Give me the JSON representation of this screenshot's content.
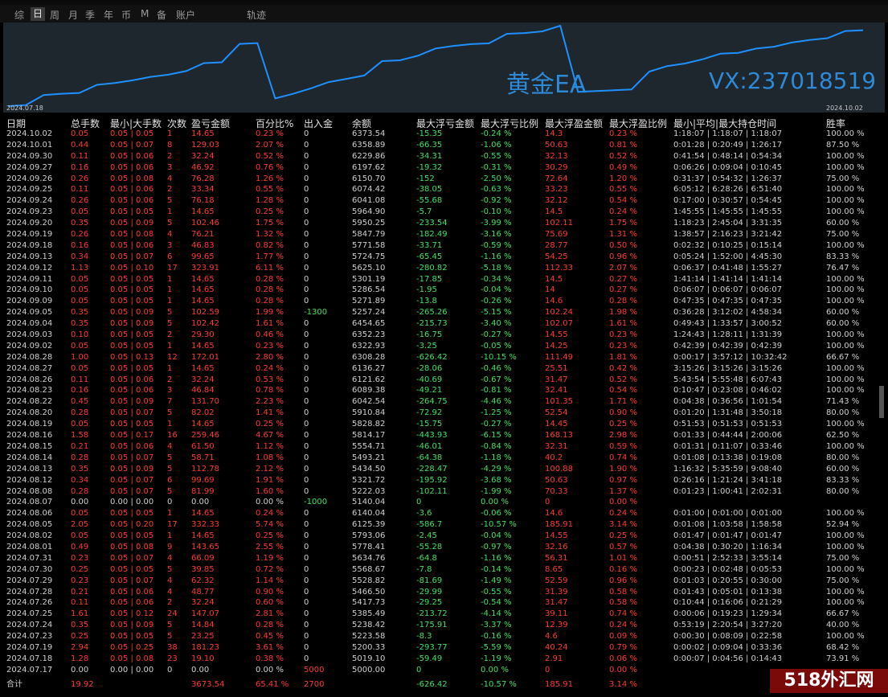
{
  "tabs": [
    {
      "label": "综"
    },
    {
      "label": "日"
    },
    {
      "label": "周"
    },
    {
      "label": "月"
    },
    {
      "label": "季"
    },
    {
      "label": "年"
    },
    {
      "label": "币"
    },
    {
      "label": "M"
    },
    {
      "label": "备"
    },
    {
      "label": "账户"
    },
    {
      "label": "轨迹"
    }
  ],
  "chart": {
    "date_start": "2024.07.18",
    "date_end": "2024.10.02",
    "watermark1": "黄金EA",
    "watermark2": "VX:237018519",
    "line_color": "#1e90ff",
    "values": [
      5000.0,
      5019.1,
      5200.33,
      5223.58,
      5238.42,
      5385.49,
      5417.73,
      5466.5,
      5528.82,
      5568.67,
      5634.76,
      5778.41,
      5793.06,
      6125.39,
      6140.04,
      5140.04,
      5222.03,
      5321.72,
      5434.5,
      5493.21,
      5554.71,
      5814.17,
      5828.82,
      5910.84,
      6042.54,
      6089.38,
      6121.62,
      6136.27,
      6308.28,
      6322.93,
      6352.23,
      6454.65,
      5257.24,
      5271.89,
      5286.54,
      5301.19,
      5625.1,
      5724.75,
      5771.58,
      5847.79,
      5950.25,
      5964.9,
      6041.08,
      6074.42,
      6150.7,
      6197.62,
      6229.86,
      6358.89,
      6373.54
    ]
  },
  "headers": [
    "日期",
    "总手数",
    "最小|大手数",
    "次数",
    "盈亏金额",
    "百分比%",
    "出入金",
    "余额",
    "最大浮亏金额",
    "最大浮亏比例",
    "最大浮盈金额",
    "最大浮盈比例",
    "最小|平均|最大持仓时间",
    "胜率"
  ],
  "rows": [
    [
      "2024.10.02",
      "0.05",
      "0.05 | 0.05",
      "1",
      "14.65",
      "0.23 %",
      "0",
      "6373.54",
      "-15.35",
      "-0.24 %",
      "14.3",
      "0.23 %",
      "1:18:07 | 1:18:07 | 1:18:07",
      "100.00 %"
    ],
    [
      "2024.10.01",
      "0.44",
      "0.05 | 0.07",
      "8",
      "129.03",
      "2.07 %",
      "0",
      "6358.89",
      "-66.35",
      "-1.06 %",
      "50.63",
      "0.81 %",
      "0:01:28 | 0:20:49 | 1:26:17",
      "87.50 %"
    ],
    [
      "2024.09.30",
      "0.11",
      "0.05 | 0.06",
      "2",
      "32.24",
      "0.52 %",
      "0",
      "6229.86",
      "-34.31",
      "-0.55 %",
      "32.13",
      "0.52 %",
      "0:41:54 | 0:48:14 | 0:54:34",
      "100.00 %"
    ],
    [
      "2024.09.27",
      "0.16",
      "0.05 | 0.06",
      "3",
      "46.92",
      "0.76 %",
      "0",
      "6197.62",
      "-19.32",
      "-0.31 %",
      "30.29",
      "0.49 %",
      "0:06:26 | 0:09:04 | 0:10:45",
      "100.00 %"
    ],
    [
      "2024.09.26",
      "0.26",
      "0.05 | 0.08",
      "4",
      "76.28",
      "1.26 %",
      "0",
      "6150.70",
      "-152",
      "-2.50 %",
      "72.64",
      "1.20 %",
      "0:31:37 | 0:54:32 | 1:26:37",
      "75.00 %"
    ],
    [
      "2024.09.25",
      "0.11",
      "0.05 | 0.06",
      "2",
      "33.34",
      "0.55 %",
      "0",
      "6074.42",
      "-38.05",
      "-0.63 %",
      "33.23",
      "0.55 %",
      "6:05:12 | 6:28:26 | 6:51:40",
      "100.00 %"
    ],
    [
      "2024.09.24",
      "0.26",
      "0.05 | 0.06",
      "5",
      "76.18",
      "1.28 %",
      "0",
      "6041.08",
      "-55.68",
      "-0.92 %",
      "32.12",
      "0.54 %",
      "0:17:00 | 0:30:57 | 0:54:45",
      "100.00 %"
    ],
    [
      "2024.09.23",
      "0.05",
      "0.05 | 0.05",
      "1",
      "14.65",
      "0.25 %",
      "0",
      "5964.90",
      "-5.7",
      "-0.10 %",
      "14.5",
      "0.24 %",
      "1:45:55 | 1:45:55 | 1:45:55",
      "100.00 %"
    ],
    [
      "2024.09.20",
      "0.35",
      "0.05 | 0.09",
      "5",
      "102.46",
      "1.75 %",
      "0",
      "5950.25",
      "-233.54",
      "-3.99 %",
      "102.11",
      "1.75 %",
      "1:18:23 | 2:45:04 | 3:31:35",
      "60.00 %"
    ],
    [
      "2024.09.19",
      "0.26",
      "0.05 | 0.08",
      "4",
      "76.21",
      "1.32 %",
      "0",
      "5847.79",
      "-182.49",
      "-3.16 %",
      "75.69",
      "1.31 %",
      "1:38:57 | 2:16:23 | 3:21:42",
      "75.00 %"
    ],
    [
      "2024.09.18",
      "0.16",
      "0.05 | 0.06",
      "3",
      "46.83",
      "0.82 %",
      "0",
      "5771.58",
      "-33.71",
      "-0.59 %",
      "28.77",
      "0.50 %",
      "0:02:32 | 0:10:25 | 0:15:14",
      "100.00 %"
    ],
    [
      "2024.09.13",
      "0.34",
      "0.05 | 0.07",
      "6",
      "99.65",
      "1.77 %",
      "0",
      "5724.75",
      "-65.45",
      "-1.16 %",
      "54.25",
      "0.96 %",
      "0:05:24 | 1:52:00 | 4:45:30",
      "83.33 %"
    ],
    [
      "2024.09.12",
      "1.13",
      "0.05 | 0.10",
      "17",
      "323.91",
      "6.11 %",
      "0",
      "5625.10",
      "-280.82",
      "-5.18 %",
      "112.33",
      "2.07 %",
      "0:06:37 | 0:41:48 | 1:55:27",
      "76.47 %"
    ],
    [
      "2024.09.11",
      "0.05",
      "0.05 | 0.05",
      "1",
      "14.65",
      "0.28 %",
      "0",
      "5301.19",
      "-17.85",
      "-0.34 %",
      "14.5",
      "0.27 %",
      "1:41:14 | 1:41:14 | 1:41:14",
      "100.00 %"
    ],
    [
      "2024.09.10",
      "0.05",
      "0.05 | 0.05",
      "1",
      "14.65",
      "0.28 %",
      "0",
      "5286.54",
      "-1.95",
      "-0.04 %",
      "14",
      "0.27 %",
      "0:06:07 | 0:06:07 | 0:06:07",
      "100.00 %"
    ],
    [
      "2024.09.09",
      "0.05",
      "0.05 | 0.05",
      "1",
      "14.65",
      "0.28 %",
      "0",
      "5271.89",
      "-13.8",
      "-0.26 %",
      "14.6",
      "0.28 %",
      "0:47:35 | 0:47:35 | 0:47:35",
      "100.00 %"
    ],
    [
      "2024.09.05",
      "0.35",
      "0.05 | 0.09",
      "5",
      "102.59",
      "1.99 %",
      "-1300",
      "5257.24",
      "-265.26",
      "-5.15 %",
      "102.24",
      "1.98 %",
      "0:36:28 | 3:12:02 | 4:58:34",
      "60.00 %"
    ],
    [
      "2024.09.04",
      "0.35",
      "0.05 | 0.09",
      "5",
      "102.42",
      "1.61 %",
      "0",
      "6454.65",
      "-215.73",
      "-3.40 %",
      "102.07",
      "1.61 %",
      "0:49:43 | 1:33:57 | 3:00:52",
      "60.00 %"
    ],
    [
      "2024.09.03",
      "0.10",
      "0.05 | 0.05",
      "2",
      "29.30",
      "0.46 %",
      "0",
      "6352.23",
      "-16.75",
      "-0.27 %",
      "14.55",
      "0.23 %",
      "1:24:43 | 1:28:11 | 1:31:39",
      "100.00 %"
    ],
    [
      "2024.09.02",
      "0.05",
      "0.05 | 0.05",
      "1",
      "14.65",
      "0.23 %",
      "0",
      "6322.93",
      "-3.25",
      "-0.05 %",
      "14.25",
      "0.23 %",
      "0:42:39 | 0:42:39 | 0:42:39",
      "100.00 %"
    ],
    [
      "2024.08.28",
      "1.00",
      "0.05 | 0.13",
      "12",
      "172.01",
      "2.80 %",
      "0",
      "6308.28",
      "-626.42",
      "-10.15 %",
      "111.49",
      "1.81 %",
      "0:00:17 | 3:57:12 | 10:32:42",
      "66.67 %"
    ],
    [
      "2024.08.27",
      "0.05",
      "0.05 | 0.05",
      "1",
      "14.65",
      "0.24 %",
      "0",
      "6136.27",
      "-28.06",
      "-0.46 %",
      "25.51",
      "0.42 %",
      "3:15:26 | 3:15:26 | 3:15:26",
      "100.00 %"
    ],
    [
      "2024.08.26",
      "0.11",
      "0.05 | 0.06",
      "2",
      "32.24",
      "0.53 %",
      "0",
      "6121.62",
      "-40.69",
      "-0.67 %",
      "31.47",
      "0.52 %",
      "5:43:54 | 5:55:48 | 6:07:43",
      "100.00 %"
    ],
    [
      "2024.08.23",
      "0.16",
      "0.05 | 0.06",
      "3",
      "46.84",
      "0.78 %",
      "0",
      "6089.38",
      "-49.21",
      "-0.81 %",
      "32.41",
      "0.54 %",
      "0:10:47 | 0:23:08 | 0:46:02",
      "100.00 %"
    ],
    [
      "2024.08.22",
      "0.45",
      "0.05 | 0.09",
      "7",
      "131.70",
      "2.23 %",
      "0",
      "6042.54",
      "-264.75",
      "-4.46 %",
      "101.35",
      "1.71 %",
      "0:04:38 | 0:36:56 | 1:01:54",
      "71.43 %"
    ],
    [
      "2024.08.20",
      "0.28",
      "0.05 | 0.07",
      "5",
      "82.02",
      "1.41 %",
      "0",
      "5910.84",
      "-72.92",
      "-1.25 %",
      "52.54",
      "0.90 %",
      "0:01:20 | 1:31:48 | 3:50:18",
      "80.00 %"
    ],
    [
      "2024.08.19",
      "0.05",
      "0.05 | 0.05",
      "1",
      "14.65",
      "0.25 %",
      "0",
      "5828.82",
      "-15.75",
      "-0.27 %",
      "14.45",
      "0.25 %",
      "0:51:53 | 0:51:53 | 0:51:53",
      "100.00 %"
    ],
    [
      "2024.08.16",
      "1.58",
      "0.05 | 0.17",
      "16",
      "259.46",
      "4.67 %",
      "0",
      "5814.17",
      "-443.93",
      "-6.15 %",
      "168.13",
      "2.98 %",
      "0:01:33 | 0:44:44 | 2:00:06",
      "62.50 %"
    ],
    [
      "2024.08.15",
      "0.21",
      "0.05 | 0.06",
      "4",
      "61.50",
      "1.12 %",
      "0",
      "5554.71",
      "-46.01",
      "-0.84 %",
      "32.31",
      "0.59 %",
      "0:01:31 | 0:11:07 | 0:33:46",
      "100.00 %"
    ],
    [
      "2024.08.14",
      "0.28",
      "0.05 | 0.07",
      "5",
      "58.71",
      "1.08 %",
      "0",
      "5493.21",
      "-64.38",
      "-1.18 %",
      "40.2",
      "0.74 %",
      "0:01:08 | 0:13:38 | 0:19:08",
      "80.00 %"
    ],
    [
      "2024.08.13",
      "0.35",
      "0.05 | 0.09",
      "5",
      "112.78",
      "2.12 %",
      "0",
      "5434.50",
      "-228.47",
      "-4.29 %",
      "100.88",
      "1.90 %",
      "1:16:32 | 5:35:59 | 9:08:40",
      "60.00 %"
    ],
    [
      "2024.08.12",
      "0.34",
      "0.05 | 0.07",
      "6",
      "99.69",
      "1.91 %",
      "0",
      "5321.72",
      "-195.92",
      "-3.68 %",
      "50.63",
      "0.97 %",
      "0:26:16 | 1:21:24 | 3:41:18",
      "83.33 %"
    ],
    [
      "2024.08.08",
      "0.28",
      "0.05 | 0.07",
      "5",
      "81.99",
      "1.60 %",
      "0",
      "5222.03",
      "-102.11",
      "-1.99 %",
      "70.33",
      "1.37 %",
      "0:01:23 | 1:00:41 | 2:02:31",
      "80.00 %"
    ],
    [
      "2024.08.07",
      "0.00",
      "0.00 | 0.00",
      "0",
      "0.00",
      "0.00 %",
      "-1000",
      "5140.04",
      "0",
      "0.00 %",
      "0",
      "0.00 %",
      "",
      ""
    ],
    [
      "2024.08.06",
      "0.05",
      "0.05 | 0.05",
      "1",
      "14.65",
      "0.24 %",
      "0",
      "6140.04",
      "-3.6",
      "-0.06 %",
      "14.6",
      "0.24 %",
      "0:01:00 | 0:01:00 | 0:01:00",
      "100.00 %"
    ],
    [
      "2024.08.05",
      "2.05",
      "0.05 | 0.20",
      "17",
      "332.33",
      "5.74 %",
      "0",
      "6125.39",
      "-586.7",
      "-10.57 %",
      "185.91",
      "3.14 %",
      "0:01:08 | 1:03:58 | 1:58:58",
      "52.94 %"
    ],
    [
      "2024.08.02",
      "0.05",
      "0.05 | 0.05",
      "1",
      "14.65",
      "0.25 %",
      "0",
      "5793.06",
      "-2.45",
      "-0.04 %",
      "14.55",
      "0.25 %",
      "0:01:47 | 0:01:47 | 0:01:47",
      "100.00 %"
    ],
    [
      "2024.08.01",
      "0.49",
      "0.05 | 0.08",
      "9",
      "143.65",
      "2.55 %",
      "0",
      "5778.41",
      "-55.28",
      "-0.97 %",
      "32.16",
      "0.57 %",
      "0:04:38 | 0:30:20 | 1:16:34",
      "100.00 %"
    ],
    [
      "2024.07.31",
      "0.23",
      "0.05 | 0.07",
      "4",
      "66.09",
      "1.19 %",
      "0",
      "5634.76",
      "-64.8",
      "-1.16 %",
      "56.31",
      "1.01 %",
      "0:00:51 | 2:52:33 | 3:55:14",
      "75.00 %"
    ],
    [
      "2024.07.30",
      "0.25",
      "0.05 | 0.05",
      "5",
      "39.85",
      "0.72 %",
      "0",
      "5568.67",
      "-7.8",
      "-0.14 %",
      "8.65",
      "0.16 %",
      "0:00:23 | 0:02:48 | 0:05:53",
      "100.00 %"
    ],
    [
      "2024.07.29",
      "0.23",
      "0.05 | 0.07",
      "4",
      "62.32",
      "1.14 %",
      "0",
      "5528.82",
      "-81.69",
      "-1.49 %",
      "52.59",
      "0.96 %",
      "0:01:03 | 0:20:55 | 0:30:00",
      "75.00 %"
    ],
    [
      "2024.07.28",
      "0.21",
      "0.05 | 0.06",
      "4",
      "48.77",
      "0.90 %",
      "0",
      "5466.50",
      "-29.99",
      "-0.55 %",
      "31.39",
      "0.58 %",
      "0:01:43 | 0:05:01 | 0:13:38",
      "100.00 %"
    ],
    [
      "2024.07.26",
      "0.11",
      "0.05 | 0.06",
      "2",
      "32.24",
      "0.60 %",
      "0",
      "5417.73",
      "-29.25",
      "-0.54 %",
      "31.47",
      "0.58 %",
      "0:10:44 | 0:16:06 | 0:21:29",
      "100.00 %"
    ],
    [
      "2024.07.25",
      "1.61",
      "0.05 | 0.12",
      "24",
      "147.07",
      "2.81 %",
      "0",
      "5385.49",
      "-213.72",
      "-4.14 %",
      "39.11",
      "0.74 %",
      "0:00:06 | 0:19:23 | 1:29:34",
      "66.67 %"
    ],
    [
      "2024.07.24",
      "0.35",
      "0.05 | 0.09",
      "5",
      "14.84",
      "0.28 %",
      "0",
      "5238.42",
      "-175.91",
      "-3.37 %",
      "12.39",
      "0.24 %",
      "0:53:19 | 2:20:54 | 3:27:20",
      "40.00 %"
    ],
    [
      "2024.07.23",
      "0.25",
      "0.05 | 0.05",
      "5",
      "23.25",
      "0.45 %",
      "0",
      "5223.58",
      "-8.3",
      "-0.16 %",
      "4.6",
      "0.09 %",
      "0:00:30 | 0:08:09 | 0:22:58",
      "100.00 %"
    ],
    [
      "2024.07.19",
      "2.94",
      "0.05 | 0.25",
      "38",
      "181.23",
      "3.61 %",
      "0",
      "5200.33",
      "-293.77",
      "-5.59 %",
      "40.24",
      "0.79 %",
      "0:00:02 | 0:09:04 | 0:33:36",
      "68.42 %"
    ],
    [
      "2024.07.18",
      "1.28",
      "0.05 | 0.08",
      "23",
      "19.10",
      "0.38 %",
      "0",
      "5019.10",
      "-59.49",
      "-1.19 %",
      "2.91",
      "0.06 %",
      "0:00:07 | 0:04:56 | 0:14:43",
      "73.91 %"
    ],
    [
      "2024.07.17",
      "0.00",
      "0.00 | 0.00",
      "0",
      "0.00",
      "0.00 %",
      "5000",
      "5000.00",
      "0",
      "0.00 %",
      "0",
      "0.00 %",
      "",
      ""
    ]
  ],
  "footer": [
    "合计",
    "19.92",
    "",
    "",
    "3673.54",
    "65.41 %",
    "2700",
    "",
    "-626.42",
    "-10.57 %",
    "185.91",
    "3.14 %",
    "",
    ""
  ],
  "logo": "518外汇网"
}
